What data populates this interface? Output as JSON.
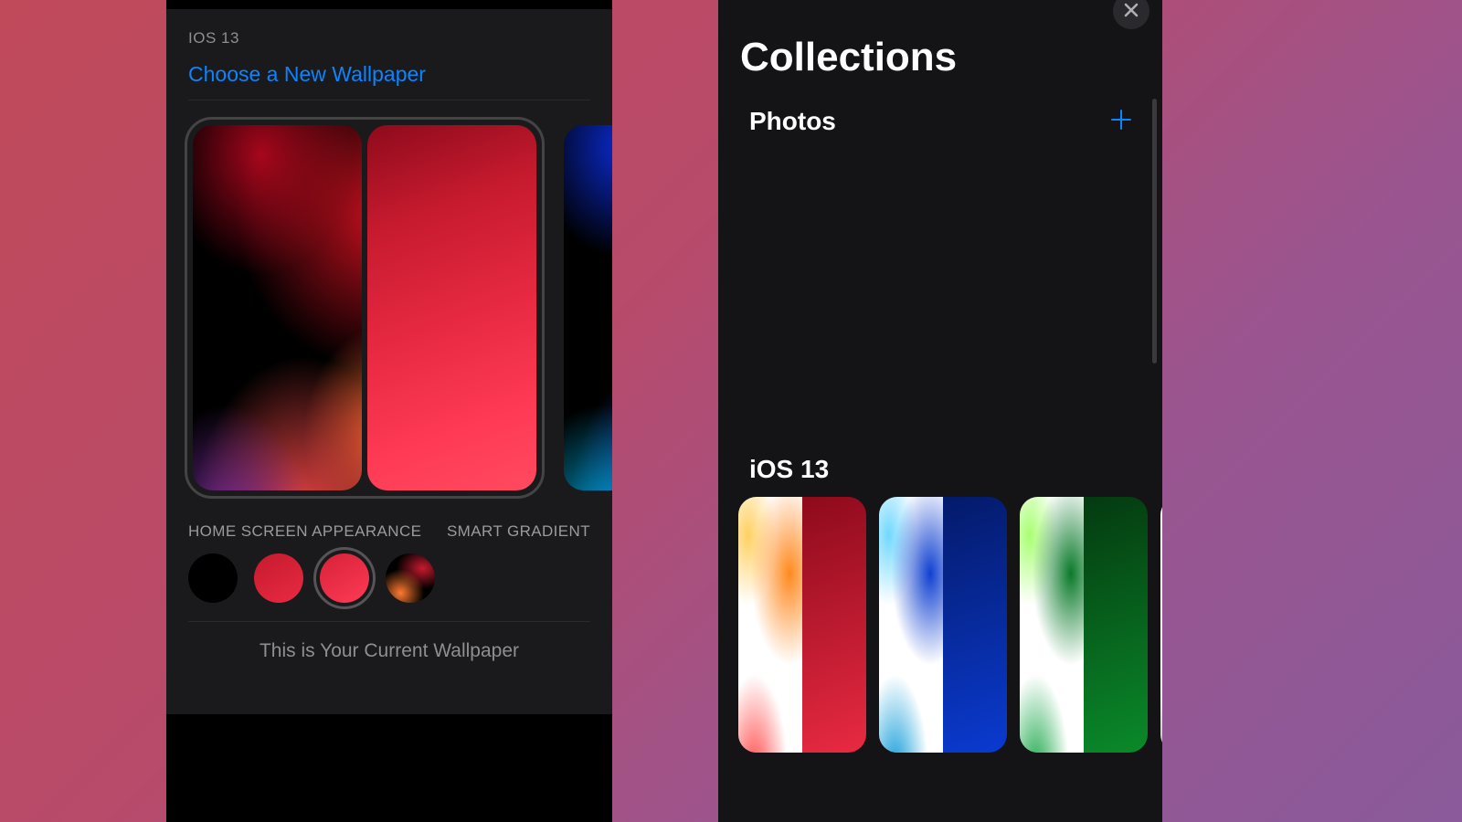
{
  "left": {
    "section_header": "IOS 13",
    "choose_link": "Choose a New Wallpaper",
    "home_appearance_label": "HOME SCREEN APPEARANCE",
    "smart_gradient_label": "SMART GRADIENT",
    "current_wallpaper_text": "This is Your Current Wallpaper"
  },
  "right": {
    "title": "Collections",
    "photos_label": "Photos",
    "ios13_label": "iOS 13"
  }
}
